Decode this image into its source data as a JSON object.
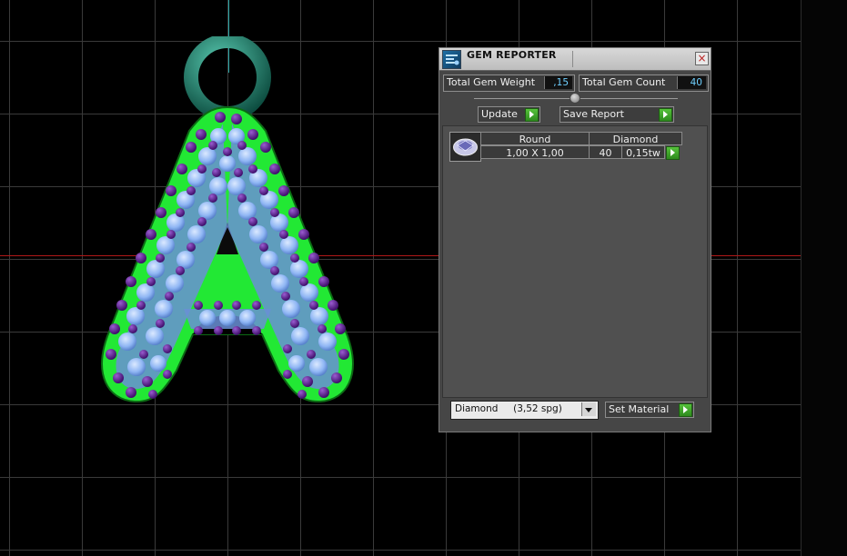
{
  "gem_reporter": {
    "title": "GEM REPORTER",
    "close_label": "×",
    "total_weight_label": "Total Gem Weight",
    "total_weight_value": ",15",
    "total_count_label": "Total Gem Count",
    "total_count_value": "40",
    "update_label": "Update",
    "save_report_label": "Save Report",
    "table": {
      "headers": [
        "Round",
        "Diamond"
      ],
      "rows": [
        {
          "size": "1,00 X 1,00",
          "count": "40",
          "weight": "0,15tw"
        }
      ]
    },
    "material_select_value": "Diamond     (3,52 spg)",
    "set_material_label": "Set Material"
  },
  "colors": {
    "metal_green": "#22e834",
    "gem_blue": "#8fb6f4",
    "prong_purple": "#5a1a8c",
    "bail_teal": "#1f8a78",
    "axis_red": "#b01818",
    "accent_green_button": "#3fa82a"
  },
  "icons": [
    "gem-reporter-app-icon",
    "close-icon",
    "play-arrow-icon",
    "round-gem-thumbnail-icon",
    "dropdown-arrow-icon"
  ]
}
